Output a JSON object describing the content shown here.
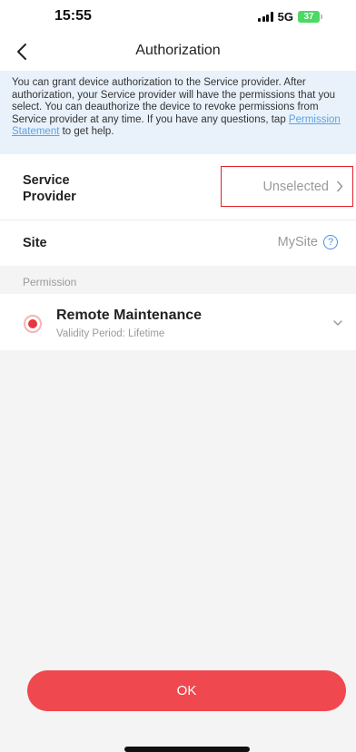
{
  "status_bar": {
    "time": "15:55",
    "network": "5G",
    "battery": "37"
  },
  "nav": {
    "title": "Authorization",
    "back_icon": "chevron-left-icon"
  },
  "info": {
    "text_before_link": "You can grant device authorization to the Service provider. After authorization, your Service provider will have the permissions that you select. You can deauthorize the device to revoke permissions from Service provider at any time. If you have any questions, tap ",
    "link_text": "Permission Statement",
    "text_after_link": " to get help."
  },
  "service_provider": {
    "label_line1": "Service",
    "label_line2": "Provider",
    "value": "Unselected"
  },
  "site": {
    "label": "Site",
    "value": "MySite",
    "help_icon": "help-circle-icon"
  },
  "permission": {
    "section_label": "Permission",
    "item_title": "Remote Maintenance",
    "item_subtitle": "Validity Period:  Lifetime"
  },
  "ok_button": {
    "label": "OK"
  },
  "colors": {
    "accent": "#f0484f",
    "highlight_border": "#e2222b",
    "link": "#5aa2e6",
    "banner_bg": "#e9f2fb"
  }
}
